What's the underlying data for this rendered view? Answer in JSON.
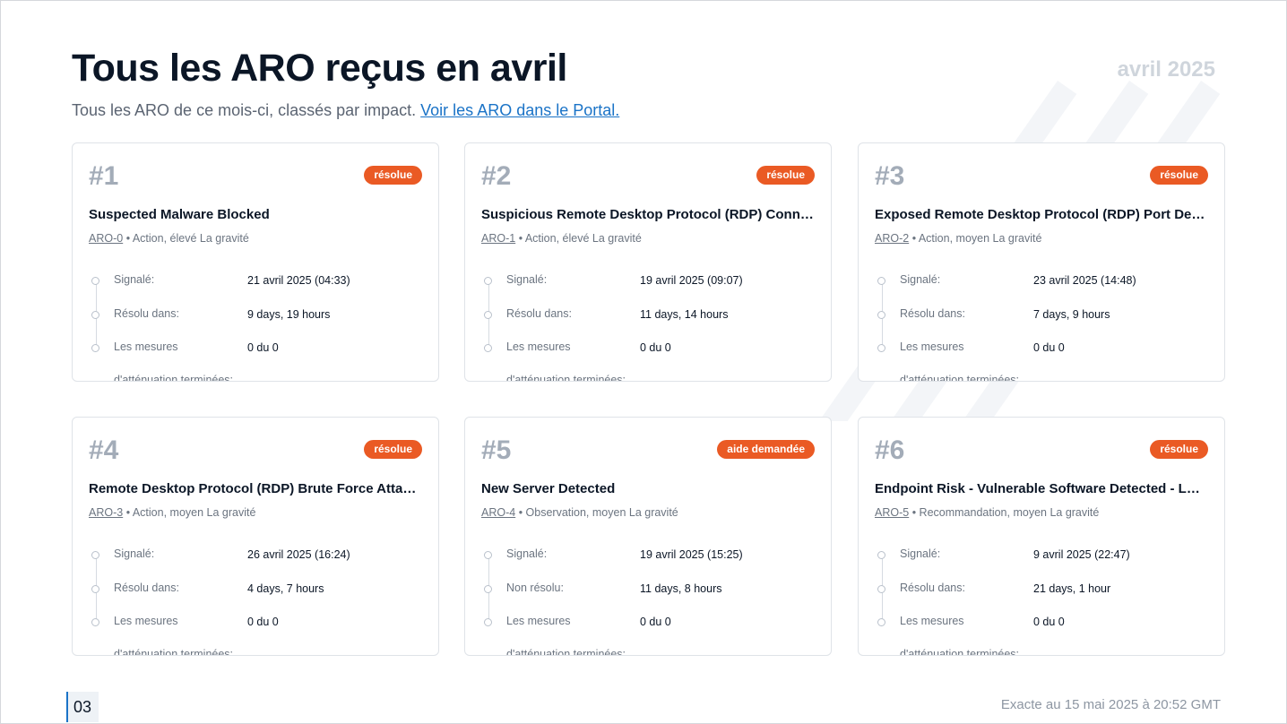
{
  "header": {
    "title": "Tous les ARO reçus en avril",
    "month": "avril 2025",
    "subtitle": "Tous les ARO de ce mois-ci, classés par impact.",
    "portal_link": "Voir les ARO dans le Portal."
  },
  "labels": {
    "reported": "Signalé:",
    "resolved_in": "Résolu dans:",
    "unresolved": "Non résolu:",
    "mitigation": "Les mesures d'atténuation terminées:",
    "severity_suffix": "La gravité"
  },
  "cards": [
    {
      "rank": "#1",
      "status": "résolue",
      "title": "Suspected Malware Blocked",
      "aro": "ARO-0",
      "meta": "• Action, élevé La gravité",
      "reported": "21 avril 2025 (04:33)",
      "duration_label": "Résolu dans:",
      "duration": "9 days, 19 hours",
      "mitigation": "0 du 0"
    },
    {
      "rank": "#2",
      "status": "résolue",
      "title": "Suspicious Remote Desktop Protocol (RDP) Conn…",
      "aro": "ARO-1",
      "meta": "• Action, élevé La gravité",
      "reported": "19 avril 2025 (09:07)",
      "duration_label": "Résolu dans:",
      "duration": "11 days, 14 hours",
      "mitigation": "0 du 0"
    },
    {
      "rank": "#3",
      "status": "résolue",
      "title": "Exposed Remote Desktop Protocol (RDP) Port De…",
      "aro": "ARO-2",
      "meta": "• Action, moyen La gravité",
      "reported": "23 avril 2025 (14:48)",
      "duration_label": "Résolu dans:",
      "duration": "7 days, 9 hours",
      "mitigation": "0 du 0"
    },
    {
      "rank": "#4",
      "status": "résolue",
      "title": "Remote Desktop Protocol (RDP) Brute Force Atta…",
      "aro": "ARO-3",
      "meta": "• Action, moyen La gravité",
      "reported": "26 avril 2025 (16:24)",
      "duration_label": "Résolu dans:",
      "duration": "4 days, 7 hours",
      "mitigation": "0 du 0"
    },
    {
      "rank": "#5",
      "status": "aide demandée",
      "title": "New Server Detected",
      "aro": "ARO-4",
      "meta": "• Observation, moyen La gravité",
      "reported": "19 avril 2025 (15:25)",
      "duration_label": "Non résolu:",
      "duration": "11 days, 8 hours",
      "mitigation": "0 du 0"
    },
    {
      "rank": "#6",
      "status": "résolue",
      "title": "Endpoint Risk - Vulnerable Software Detected - L…",
      "aro": "ARO-5",
      "meta": "• Recommandation, moyen La gravité",
      "reported": "9 avril 2025 (22:47)",
      "duration_label": "Résolu dans:",
      "duration": "21 days, 1 hour",
      "mitigation": "0 du 0"
    }
  ],
  "footer": {
    "page_number": "03",
    "accuracy": "Exacte au 15 mai 2025 à 20:52 GMT"
  },
  "colors": {
    "accent": "#ea5a24",
    "link": "#1a73c7"
  }
}
